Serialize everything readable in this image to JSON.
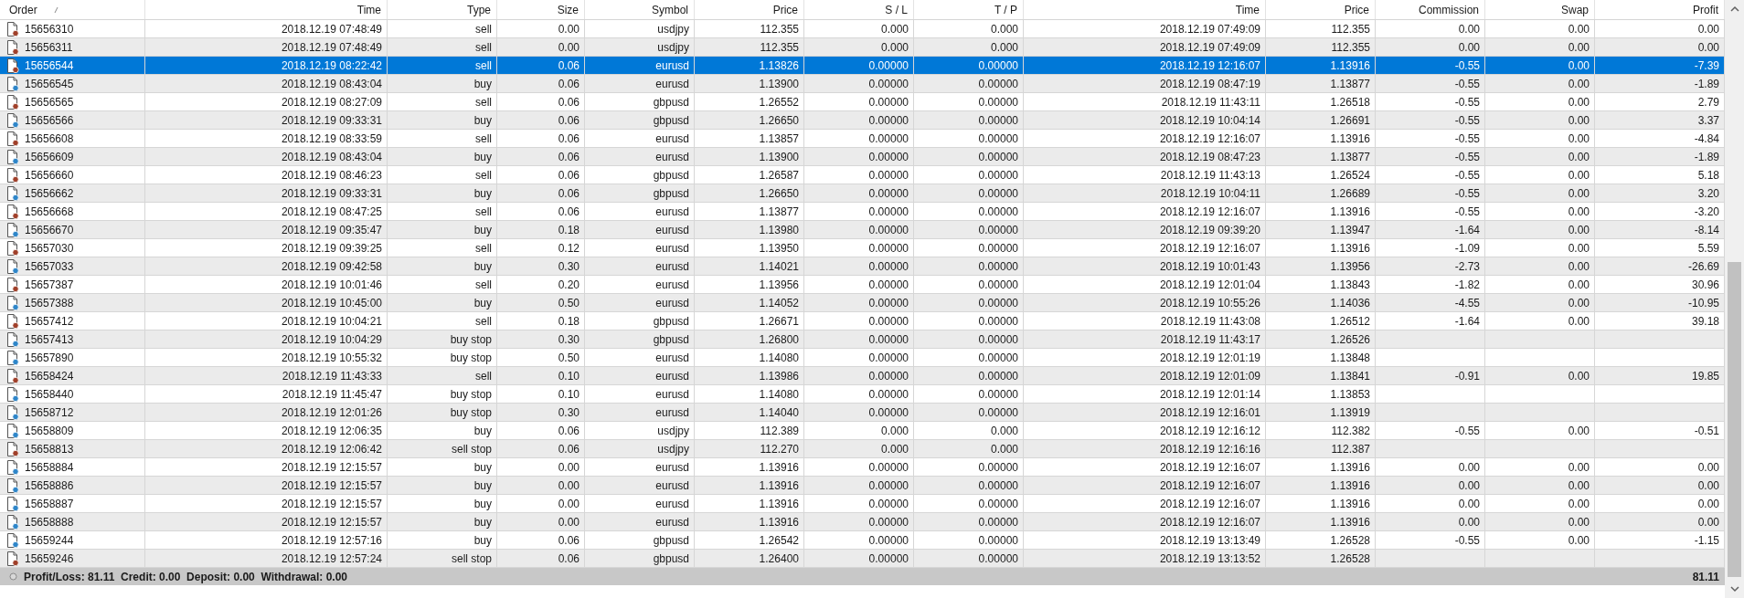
{
  "columns": [
    {
      "label": "Order",
      "sorted": true
    },
    {
      "label": "Time",
      "sorted": false
    },
    {
      "label": "Type",
      "sorted": false
    },
    {
      "label": "Size",
      "sorted": false
    },
    {
      "label": "Symbol",
      "sorted": false
    },
    {
      "label": "Price",
      "sorted": false
    },
    {
      "label": "S / L",
      "sorted": false
    },
    {
      "label": "T / P",
      "sorted": false
    },
    {
      "label": "Time",
      "sorted": false
    },
    {
      "label": "Price",
      "sorted": false
    },
    {
      "label": "Commission",
      "sorted": false
    },
    {
      "label": "Swap",
      "sorted": false
    },
    {
      "label": "Profit",
      "sorted": false
    }
  ],
  "rows": [
    {
      "kind": "sell",
      "selected": false,
      "cells": [
        "15656310",
        "2018.12.19 07:48:49",
        "sell",
        "0.00",
        "usdjpy",
        "112.355",
        "0.000",
        "0.000",
        "2018.12.19 07:49:09",
        "112.355",
        "0.00",
        "0.00",
        "0.00"
      ]
    },
    {
      "kind": "sell",
      "selected": false,
      "cells": [
        "15656311",
        "2018.12.19 07:48:49",
        "sell",
        "0.00",
        "usdjpy",
        "112.355",
        "0.000",
        "0.000",
        "2018.12.19 07:49:09",
        "112.355",
        "0.00",
        "0.00",
        "0.00"
      ]
    },
    {
      "kind": "sell",
      "selected": true,
      "cells": [
        "15656544",
        "2018.12.19 08:22:42",
        "sell",
        "0.06",
        "eurusd",
        "1.13826",
        "0.00000",
        "0.00000",
        "2018.12.19 12:16:07",
        "1.13916",
        "-0.55",
        "0.00",
        "-7.39"
      ]
    },
    {
      "kind": "buy",
      "selected": false,
      "cells": [
        "15656545",
        "2018.12.19 08:43:04",
        "buy",
        "0.06",
        "eurusd",
        "1.13900",
        "0.00000",
        "0.00000",
        "2018.12.19 08:47:19",
        "1.13877",
        "-0.55",
        "0.00",
        "-1.89"
      ]
    },
    {
      "kind": "sell",
      "selected": false,
      "cells": [
        "15656565",
        "2018.12.19 08:27:09",
        "sell",
        "0.06",
        "gbpusd",
        "1.26552",
        "0.00000",
        "0.00000",
        "2018.12.19 11:43:11",
        "1.26518",
        "-0.55",
        "0.00",
        "2.79"
      ]
    },
    {
      "kind": "buy",
      "selected": false,
      "cells": [
        "15656566",
        "2018.12.19 09:33:31",
        "buy",
        "0.06",
        "gbpusd",
        "1.26650",
        "0.00000",
        "0.00000",
        "2018.12.19 10:04:14",
        "1.26691",
        "-0.55",
        "0.00",
        "3.37"
      ]
    },
    {
      "kind": "sell",
      "selected": false,
      "cells": [
        "15656608",
        "2018.12.19 08:33:59",
        "sell",
        "0.06",
        "eurusd",
        "1.13857",
        "0.00000",
        "0.00000",
        "2018.12.19 12:16:07",
        "1.13916",
        "-0.55",
        "0.00",
        "-4.84"
      ]
    },
    {
      "kind": "buy",
      "selected": false,
      "cells": [
        "15656609",
        "2018.12.19 08:43:04",
        "buy",
        "0.06",
        "eurusd",
        "1.13900",
        "0.00000",
        "0.00000",
        "2018.12.19 08:47:23",
        "1.13877",
        "-0.55",
        "0.00",
        "-1.89"
      ]
    },
    {
      "kind": "sell",
      "selected": false,
      "cells": [
        "15656660",
        "2018.12.19 08:46:23",
        "sell",
        "0.06",
        "gbpusd",
        "1.26587",
        "0.00000",
        "0.00000",
        "2018.12.19 11:43:13",
        "1.26524",
        "-0.55",
        "0.00",
        "5.18"
      ]
    },
    {
      "kind": "buy",
      "selected": false,
      "cells": [
        "15656662",
        "2018.12.19 09:33:31",
        "buy",
        "0.06",
        "gbpusd",
        "1.26650",
        "0.00000",
        "0.00000",
        "2018.12.19 10:04:11",
        "1.26689",
        "-0.55",
        "0.00",
        "3.20"
      ]
    },
    {
      "kind": "sell",
      "selected": false,
      "cells": [
        "15656668",
        "2018.12.19 08:47:25",
        "sell",
        "0.06",
        "eurusd",
        "1.13877",
        "0.00000",
        "0.00000",
        "2018.12.19 12:16:07",
        "1.13916",
        "-0.55",
        "0.00",
        "-3.20"
      ]
    },
    {
      "kind": "buy",
      "selected": false,
      "cells": [
        "15656670",
        "2018.12.19 09:35:47",
        "buy",
        "0.18",
        "eurusd",
        "1.13980",
        "0.00000",
        "0.00000",
        "2018.12.19 09:39:20",
        "1.13947",
        "-1.64",
        "0.00",
        "-8.14"
      ]
    },
    {
      "kind": "sell",
      "selected": false,
      "cells": [
        "15657030",
        "2018.12.19 09:39:25",
        "sell",
        "0.12",
        "eurusd",
        "1.13950",
        "0.00000",
        "0.00000",
        "2018.12.19 12:16:07",
        "1.13916",
        "-1.09",
        "0.00",
        "5.59"
      ]
    },
    {
      "kind": "buy",
      "selected": false,
      "cells": [
        "15657033",
        "2018.12.19 09:42:58",
        "buy",
        "0.30",
        "eurusd",
        "1.14021",
        "0.00000",
        "0.00000",
        "2018.12.19 10:01:43",
        "1.13956",
        "-2.73",
        "0.00",
        "-26.69"
      ]
    },
    {
      "kind": "sell",
      "selected": false,
      "cells": [
        "15657387",
        "2018.12.19 10:01:46",
        "sell",
        "0.20",
        "eurusd",
        "1.13956",
        "0.00000",
        "0.00000",
        "2018.12.19 12:01:04",
        "1.13843",
        "-1.82",
        "0.00",
        "30.96"
      ]
    },
    {
      "kind": "buy",
      "selected": false,
      "cells": [
        "15657388",
        "2018.12.19 10:45:00",
        "buy",
        "0.50",
        "eurusd",
        "1.14052",
        "0.00000",
        "0.00000",
        "2018.12.19 10:55:26",
        "1.14036",
        "-4.55",
        "0.00",
        "-10.95"
      ]
    },
    {
      "kind": "sell",
      "selected": false,
      "cells": [
        "15657412",
        "2018.12.19 10:04:21",
        "sell",
        "0.18",
        "gbpusd",
        "1.26671",
        "0.00000",
        "0.00000",
        "2018.12.19 11:43:08",
        "1.26512",
        "-1.64",
        "0.00",
        "39.18"
      ]
    },
    {
      "kind": "buy",
      "selected": false,
      "cells": [
        "15657413",
        "2018.12.19 10:04:29",
        "buy stop",
        "0.30",
        "gbpusd",
        "1.26800",
        "0.00000",
        "0.00000",
        "2018.12.19 11:43:17",
        "1.26526",
        null,
        null,
        null
      ]
    },
    {
      "kind": "buy",
      "selected": false,
      "cells": [
        "15657890",
        "2018.12.19 10:55:32",
        "buy stop",
        "0.50",
        "eurusd",
        "1.14080",
        "0.00000",
        "0.00000",
        "2018.12.19 12:01:19",
        "1.13848",
        null,
        null,
        null
      ]
    },
    {
      "kind": "sell",
      "selected": false,
      "cells": [
        "15658424",
        "2018.12.19 11:43:33",
        "sell",
        "0.10",
        "eurusd",
        "1.13986",
        "0.00000",
        "0.00000",
        "2018.12.19 12:01:09",
        "1.13841",
        "-0.91",
        "0.00",
        "19.85"
      ]
    },
    {
      "kind": "buy",
      "selected": false,
      "cells": [
        "15658440",
        "2018.12.19 11:45:47",
        "buy stop",
        "0.10",
        "eurusd",
        "1.14080",
        "0.00000",
        "0.00000",
        "2018.12.19 12:01:14",
        "1.13853",
        null,
        null,
        null
      ]
    },
    {
      "kind": "buy",
      "selected": false,
      "cells": [
        "15658712",
        "2018.12.19 12:01:26",
        "buy stop",
        "0.30",
        "eurusd",
        "1.14040",
        "0.00000",
        "0.00000",
        "2018.12.19 12:16:01",
        "1.13919",
        null,
        null,
        null
      ]
    },
    {
      "kind": "buy",
      "selected": false,
      "cells": [
        "15658809",
        "2018.12.19 12:06:35",
        "buy",
        "0.06",
        "usdjpy",
        "112.389",
        "0.000",
        "0.000",
        "2018.12.19 12:16:12",
        "112.382",
        "-0.55",
        "0.00",
        "-0.51"
      ]
    },
    {
      "kind": "sell",
      "selected": false,
      "cells": [
        "15658813",
        "2018.12.19 12:06:42",
        "sell stop",
        "0.06",
        "usdjpy",
        "112.270",
        "0.000",
        "0.000",
        "2018.12.19 12:16:16",
        "112.387",
        null,
        null,
        null
      ]
    },
    {
      "kind": "buy",
      "selected": false,
      "cells": [
        "15658884",
        "2018.12.19 12:15:57",
        "buy",
        "0.00",
        "eurusd",
        "1.13916",
        "0.00000",
        "0.00000",
        "2018.12.19 12:16:07",
        "1.13916",
        "0.00",
        "0.00",
        "0.00"
      ]
    },
    {
      "kind": "buy",
      "selected": false,
      "cells": [
        "15658886",
        "2018.12.19 12:15:57",
        "buy",
        "0.00",
        "eurusd",
        "1.13916",
        "0.00000",
        "0.00000",
        "2018.12.19 12:16:07",
        "1.13916",
        "0.00",
        "0.00",
        "0.00"
      ]
    },
    {
      "kind": "buy",
      "selected": false,
      "cells": [
        "15658887",
        "2018.12.19 12:15:57",
        "buy",
        "0.00",
        "eurusd",
        "1.13916",
        "0.00000",
        "0.00000",
        "2018.12.19 12:16:07",
        "1.13916",
        "0.00",
        "0.00",
        "0.00"
      ]
    },
    {
      "kind": "buy",
      "selected": false,
      "cells": [
        "15658888",
        "2018.12.19 12:15:57",
        "buy",
        "0.00",
        "eurusd",
        "1.13916",
        "0.00000",
        "0.00000",
        "2018.12.19 12:16:07",
        "1.13916",
        "0.00",
        "0.00",
        "0.00"
      ]
    },
    {
      "kind": "buy",
      "selected": false,
      "cells": [
        "15659244",
        "2018.12.19 12:57:16",
        "buy",
        "0.06",
        "gbpusd",
        "1.26542",
        "0.00000",
        "0.00000",
        "2018.12.19 13:13:49",
        "1.26528",
        "-0.55",
        "0.00",
        "-1.15"
      ]
    },
    {
      "kind": "sell",
      "selected": false,
      "cells": [
        "15659246",
        "2018.12.19 12:57:24",
        "sell stop",
        "0.06",
        "gbpusd",
        "1.26400",
        "0.00000",
        "0.00000",
        "2018.12.19 13:13:52",
        "1.26528",
        null,
        null,
        null
      ]
    }
  ],
  "summary": {
    "text": "Profit/Loss: 81.11  Credit: 0.00  Deposit: 0.00  Withdrawal: 0.00",
    "total": "81.11"
  }
}
